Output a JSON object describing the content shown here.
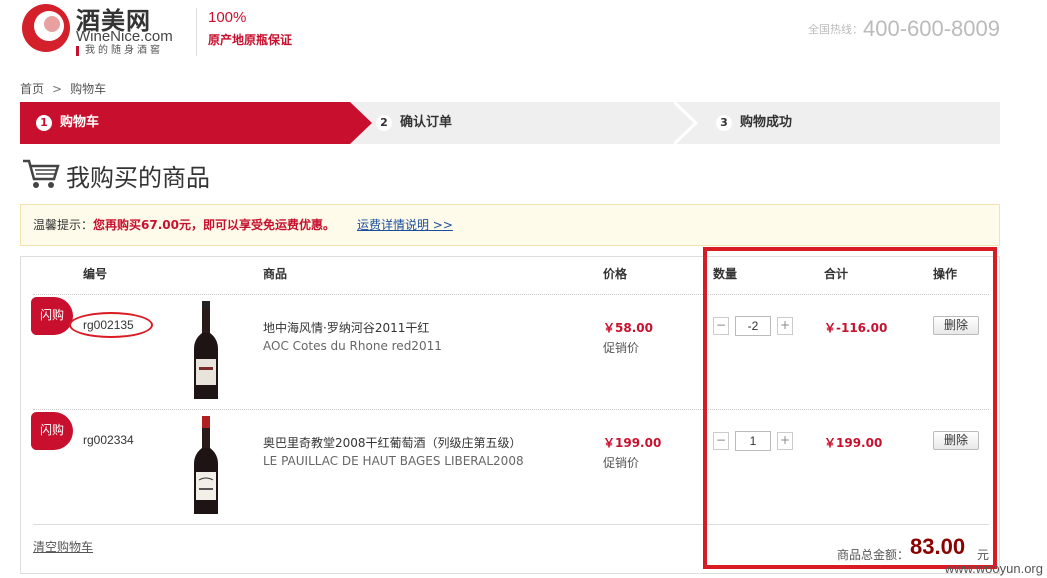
{
  "header": {
    "logo_cn": "酒美网",
    "logo_en": "WineNice.com",
    "logo_slogan": "我的随身酒窖",
    "guarantee_pct": "100%",
    "guarantee_text": "原产地原瓶保证",
    "hotline_label": "全国热线：",
    "hotline_number": "400-600-8009"
  },
  "breadcrumb": {
    "home": "首页",
    "separator": ">",
    "current": "购物车"
  },
  "steps": [
    {
      "num": "1",
      "label": "购物车",
      "active": true
    },
    {
      "num": "2",
      "label": "确认订单",
      "active": false
    },
    {
      "num": "3",
      "label": "购物成功",
      "active": false
    }
  ],
  "page_title": "我购买的商品",
  "notice": {
    "label": "温馨提示：",
    "message": "您再购买67.00元，即可以享受免运费优惠。",
    "link": "运费详情说明 >>"
  },
  "table": {
    "headers": {
      "sku": "编号",
      "product": "商品",
      "price": "价格",
      "quantity": "数量",
      "subtotal": "合计",
      "action": "操作"
    },
    "rows": [
      {
        "badge": "闪购",
        "sku": "rg002135",
        "name_cn": "地中海风情·罗纳河谷2011干红",
        "name_en": "AOC Cotes du Rhone red2011",
        "price": "￥58.00",
        "price_note": "促销价",
        "qty_minus": "−",
        "quantity": "-2",
        "qty_plus": "+",
        "subtotal": "￥-116.00",
        "delete_label": "删除"
      },
      {
        "badge": "闪购",
        "sku": "rg002334",
        "name_cn": "奥巴里奇教堂2008干红葡萄酒（列级庄第五级）",
        "name_en": "LE PAUILLAC DE HAUT BAGES LIBERAL2008",
        "price": "￥199.00",
        "price_note": "促销价",
        "qty_minus": "−",
        "quantity": "1",
        "qty_plus": "+",
        "subtotal": "￥199.00",
        "delete_label": "删除"
      }
    ]
  },
  "footer": {
    "clear_cart": "清空购物车",
    "total_label": "商品总金额：",
    "total_value": "83.00",
    "total_unit": "元"
  },
  "watermark": "www.wooyun.org",
  "colors": {
    "brand_red": "#c8102e",
    "annotation_red": "#d91c23",
    "total_dark_red": "#8b0000"
  }
}
